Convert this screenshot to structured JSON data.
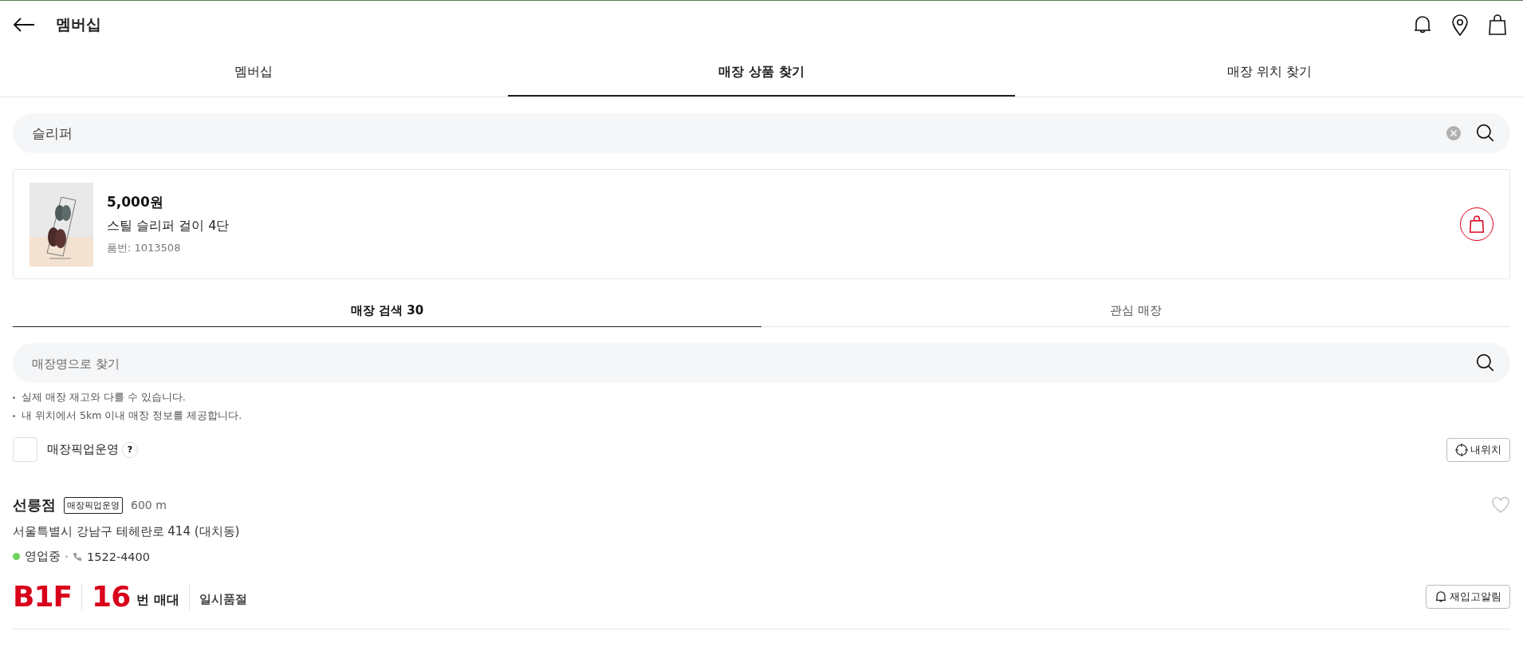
{
  "header": {
    "title": "멤버십"
  },
  "tabs": [
    {
      "label": "멤버십",
      "selected": false
    },
    {
      "label": "매장 상품 찾기",
      "selected": true
    },
    {
      "label": "매장 위치 찾기",
      "selected": false
    }
  ],
  "search": {
    "value": "슬리퍼"
  },
  "product": {
    "price": "5,000",
    "currency": "원",
    "name": "스틸 슬리퍼 걸이 4단",
    "code": "품번: 1013508"
  },
  "store_tabs": [
    {
      "label": "매장 검색 30",
      "selected": true
    },
    {
      "label": "관심 매장",
      "selected": false
    }
  ],
  "store_search": {
    "placeholder": "매장명으로 찾기"
  },
  "notes": [
    "실제 매장 재고와 다를 수 있습니다.",
    "내 위치에서 5km 이내 매장 정보를 제공합니다."
  ],
  "pickup_filter": {
    "label": "매장픽업운영",
    "checked": false,
    "help": "?"
  },
  "my_location_button": "내위치",
  "stores": [
    {
      "name": "선릉점",
      "badge": "매장픽업운영",
      "distance": "600 m",
      "favorite": false,
      "address": "서울특별시 강남구 테헤란로 414 (대치동)",
      "status": "영업중",
      "color": "#6cd45a",
      "phone": "1522-4400",
      "floor": "B1F",
      "shelf": "16",
      "shelf_unit": "번 매대",
      "stock": "일시품절",
      "restock_button": "재입고알림"
    }
  ]
}
